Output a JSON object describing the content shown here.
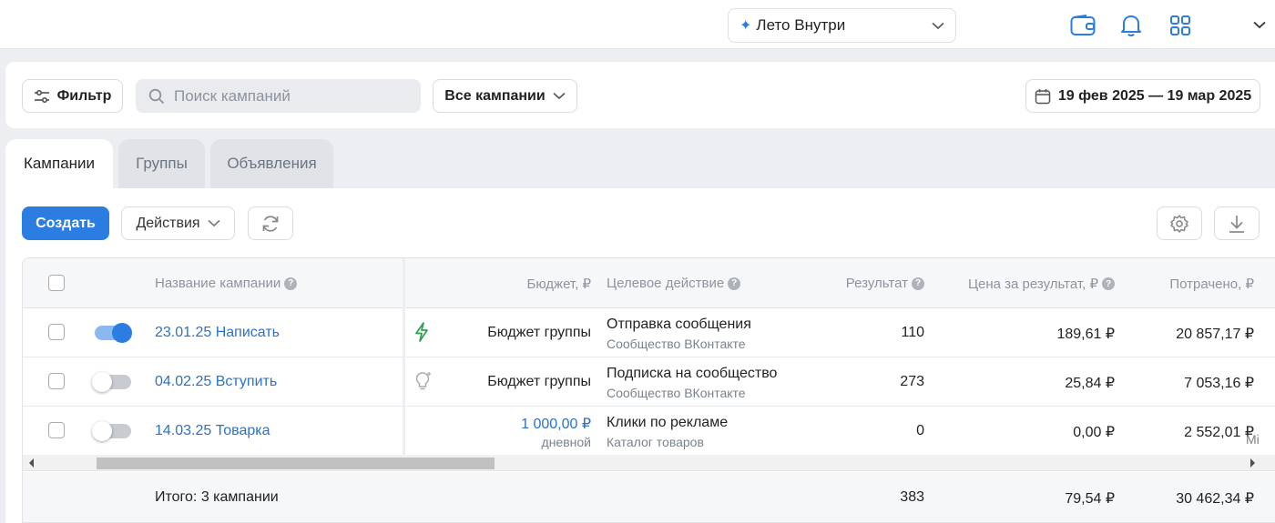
{
  "topbar": {
    "account_name": "Лето Внутри",
    "icons": [
      "wallet-icon",
      "bell-icon",
      "apps-grid-icon",
      "chevron-down-icon"
    ],
    "accent_color": "#2b7de1"
  },
  "filters": {
    "filter_label": "Фильтр",
    "search_placeholder": "Поиск кампаний",
    "campaign_select": "Все кампании",
    "date_range": "19 фев 2025 — 19 мар 2025"
  },
  "tabs": [
    {
      "label": "Кампании",
      "active": true
    },
    {
      "label": "Группы",
      "active": false
    },
    {
      "label": "Объявления",
      "active": false
    }
  ],
  "toolbar": {
    "create_label": "Создать",
    "actions_label": "Действия"
  },
  "table": {
    "headers": {
      "name": "Название кампании",
      "budget": "Бюджет, ₽",
      "target": "Целевое действие",
      "result": "Результат",
      "price": "Цена за результат, ₽",
      "spent": "Потрачено, ₽"
    },
    "rows": [
      {
        "enabled": true,
        "name": "23.01.25 Написать",
        "budget_icon": "lightning-icon",
        "budget": "Бюджет группы",
        "budget_sub": "",
        "target": "Отправка сообщения",
        "target_sub": "Сообщество ВКонтакте",
        "result": "110",
        "price": "189,61 ₽",
        "spent": "20 857,17 ₽"
      },
      {
        "enabled": false,
        "name": "04.02.25 Вступить",
        "budget_icon": "lightbulb-icon",
        "budget": "Бюджет группы",
        "budget_sub": "",
        "target": "Подписка на сообщество",
        "target_sub": "Сообщество ВКонтакте",
        "result": "273",
        "price": "25,84 ₽",
        "spent": "7 053,16 ₽"
      },
      {
        "enabled": false,
        "name": "14.03.25 Товарка",
        "budget_icon": "",
        "budget": "1 000,00 ₽",
        "budget_sub": "дневной",
        "target": "Клики по рекламе",
        "target_sub": "Каталог товаров",
        "result": "0",
        "price": "0,00 ₽",
        "spent": "2 552,01 ₽"
      }
    ],
    "overflow_text": "Мі",
    "totals": {
      "label": "Итого: 3 кампании",
      "result": "383",
      "price": "79,54 ₽",
      "spent": "30 462,34 ₽"
    }
  }
}
